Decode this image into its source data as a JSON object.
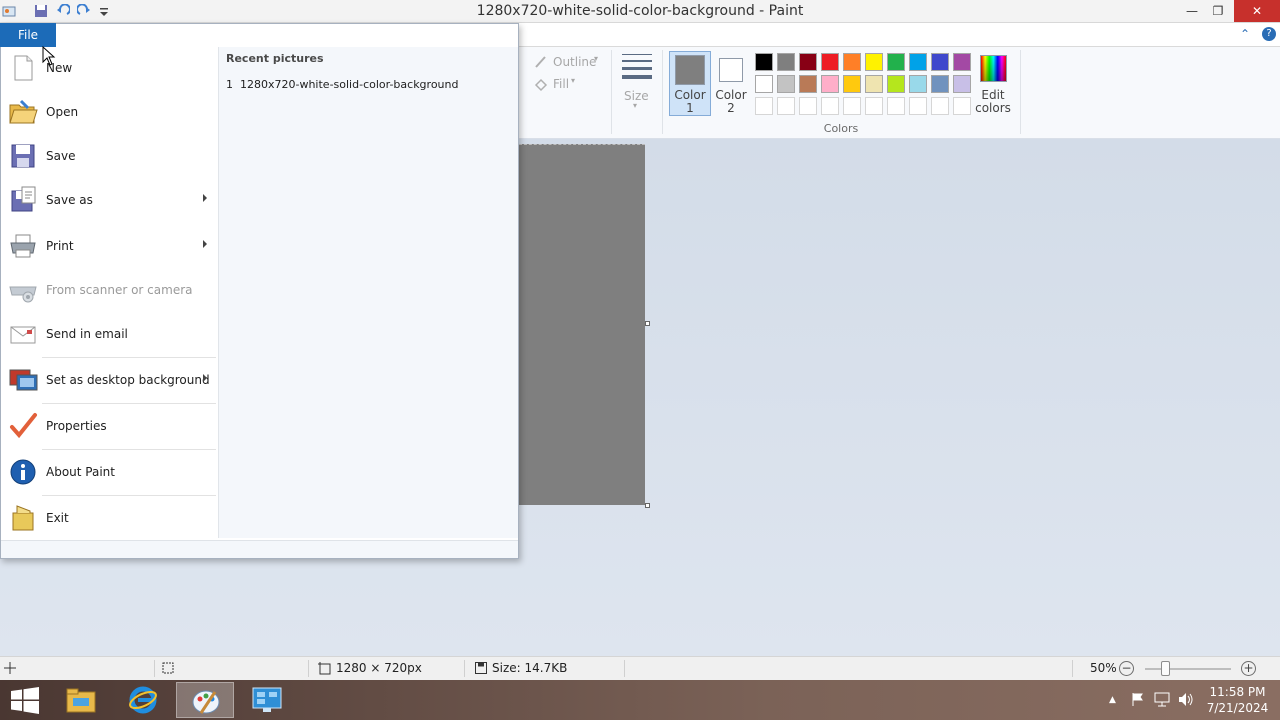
{
  "window": {
    "title": "1280x720-white-solid-color-background - Paint",
    "minimize": "—",
    "restore": "❐",
    "close": "✕"
  },
  "ribbon": {
    "file_tab": "File",
    "outline_label": "Outline",
    "fill_label": "Fill",
    "size_label": "Size",
    "color1_label": "Color",
    "color1_num": "1",
    "color2_label": "Color",
    "color2_num": "2",
    "colors_group": "Colors",
    "edit_colors_line1": "Edit",
    "edit_colors_line2": "colors",
    "color1_value": "#7f7f7f",
    "color2_value": "#ffffff",
    "palette_row1": [
      "#000000",
      "#7f7f7f",
      "#880015",
      "#ed1c24",
      "#ff7f27",
      "#fff200",
      "#22b14c",
      "#00a2e8",
      "#3f48cc",
      "#a349a4"
    ],
    "palette_row2": [
      "#ffffff",
      "#c3c3c3",
      "#b97a57",
      "#ffaec9",
      "#ffc90e",
      "#efe4b0",
      "#b5e61d",
      "#99d9ea",
      "#7092be",
      "#c8bfe7"
    ]
  },
  "file_menu": {
    "items": [
      {
        "label": "New"
      },
      {
        "label": "Open"
      },
      {
        "label": "Save"
      },
      {
        "label": "Save as"
      },
      {
        "label": "Print"
      },
      {
        "label": "From scanner or camera"
      },
      {
        "label": "Send in email"
      },
      {
        "label": "Set as desktop background"
      },
      {
        "label": "Properties"
      },
      {
        "label": "About Paint"
      },
      {
        "label": "Exit"
      }
    ],
    "recent_title": "Recent pictures",
    "recent": [
      {
        "num": "1",
        "name": "1280x720-white-solid-color-background"
      }
    ]
  },
  "statusbar": {
    "dimensions": "1280 × 720px",
    "size": "Size: 14.7KB",
    "zoom": "50%",
    "zoom_level": 0.25,
    "zoom_out": "−",
    "zoom_in": "+"
  },
  "taskbar": {
    "time": "11:58 PM",
    "date": "7/21/2024"
  }
}
